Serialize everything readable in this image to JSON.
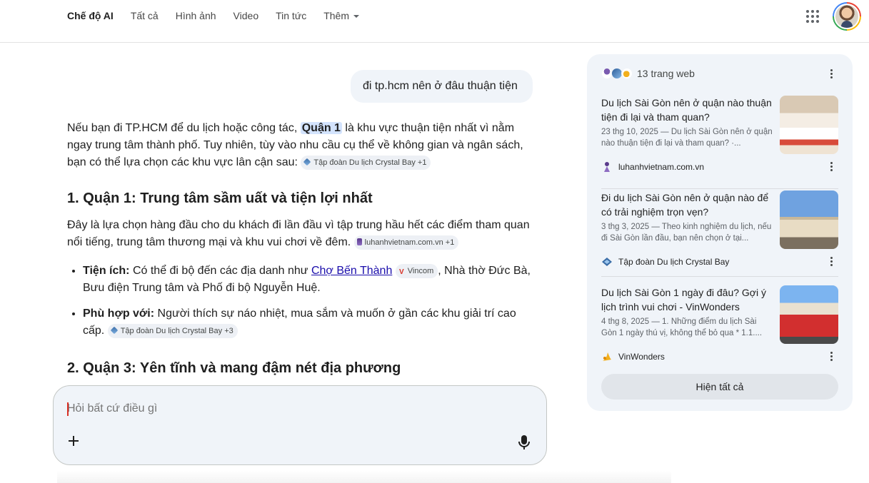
{
  "tabs": [
    {
      "label": "Chế độ AI",
      "active": true
    },
    {
      "label": "Tất cả"
    },
    {
      "label": "Hình ảnh"
    },
    {
      "label": "Video"
    },
    {
      "label": "Tin tức"
    },
    {
      "label": "Thêm"
    }
  ],
  "header": {
    "apps_icon": "apps-grid-icon",
    "avatar_icon": "account-avatar"
  },
  "user_query": "đi tp.hcm nên ở đâu thuận tiện",
  "answer": {
    "intro_1": "Nếu bạn đi TP.HCM để du lịch hoặc công tác, ",
    "intro_hl": "Quận 1",
    "intro_2": " là khu vực thuận tiện nhất vì nằm ngay trung tâm thành phố. Tuy nhiên, tùy vào nhu cầu cụ thể về không gian và ngân sách, bạn có thể lựa chọn các khu vực lân cận sau: ",
    "intro_chip": "Tập đoàn Du lịch Crystal Bay +1",
    "h1": "1. Quận 1: Trung tâm sầm uất và tiện lợi nhất",
    "p1": "Đây là lựa chọn hàng đầu cho du khách đi lần đầu vì tập trung hầu hết các điểm tham quan nổi tiếng, trung tâm thương mại và khu vui chơi về đêm. ",
    "p1_chip": "luhanhvietnam.com.vn +1",
    "b1_label": "Tiện ích:",
    "b1_text1": " Có thể đi bộ đến các địa danh như ",
    "b1_link": "Chợ Bến Thành",
    "b1_chip": "Vincom",
    "b1_text2": ", Nhà thờ Đức Bà, Bưu điện Trung tâm và Phố đi bộ Nguyễn Huệ.",
    "b2_label": "Phù hợp với:",
    "b2_text": " Người thích sự náo nhiệt, mua sắm và muốn ở gần các khu giải trí cao cấp. ",
    "b2_chip": "Tập đoàn Du lịch Crystal Bay +3",
    "h2": "2. Quận 3: Yên tĩnh và mang đậm nét địa phương"
  },
  "composer": {
    "placeholder": "Hỏi bất cứ điều gì"
  },
  "sources": {
    "count_label": "13 trang web",
    "show_all": "Hiện tất cả",
    "cards": [
      {
        "title": "Du lịch Sài Gòn nên ở quận nào thuận tiện đi lại và tham quan?",
        "snippet": "23 thg 10, 2025 — Du lịch Sài Gòn nên ở quận nào thuận tiện đi lại và tham quan? ·...",
        "source": "luhanhvietnam.com.vn"
      },
      {
        "title": "Đi du lịch Sài Gòn nên ở quận nào để có trải nghiệm trọn vẹn?",
        "snippet": "3 thg 3, 2025 — Theo kinh nghiệm du lịch, nếu đi Sài Gòn lần đầu, bạn nên chọn ở tại...",
        "source": "Tập đoàn Du lịch Crystal Bay"
      },
      {
        "title": "Du lịch Sài Gòn 1 ngày đi đâu? Gợi ý lịch trình vui chơi - VinWonders",
        "snippet": "4 thg 8, 2025 — 1. Những điểm du lịch Sài Gòn 1 ngày thú vị, không thể bỏ qua * 1.1....",
        "source": "VinWonders"
      }
    ]
  }
}
